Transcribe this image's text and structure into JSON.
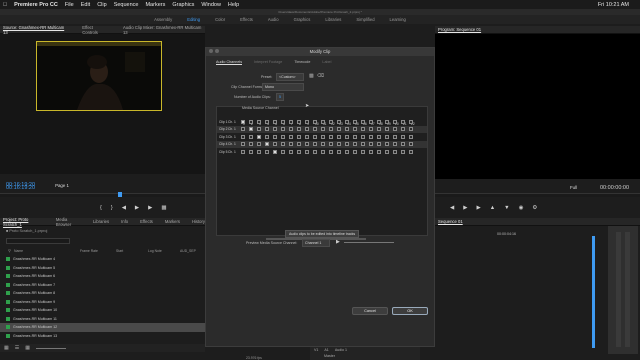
{
  "menubar": {
    "app": "Premiere Pro CC",
    "items": [
      "File",
      "Edit",
      "Clip",
      "Sequence",
      "Markers",
      "Graphics",
      "Window",
      "Help"
    ],
    "clock": "Fri 10:21 AM"
  },
  "titlebar": "/Users/dave/Documents/Adobe/Premiere Pro/Gnash_2.prproj *",
  "workspaces": {
    "items": [
      "Assembly",
      "Editing",
      "Color",
      "Effects",
      "Audio",
      "Graphics",
      "Libraries",
      "Simplified",
      "Learning"
    ]
  },
  "source_panel": {
    "tabs": [
      "Source: Gnashmex-RR Multicam 13",
      "Effect Controls",
      "Audio Clip Mixer: Gnashmex-RR Multicam 13",
      "Metadata"
    ],
    "timecode": "00:16:19:20",
    "page": "Page 1"
  },
  "program_panel": {
    "tab": "Program: Sequence 01",
    "zoom": "Full",
    "timecode": "00:00:00:00"
  },
  "project_panel": {
    "tabs": [
      "Project: Proto Scratch_1",
      "Media Browser",
      "Libraries",
      "Info",
      "Effects",
      "Markers",
      "History"
    ],
    "path": "Proto Scratch_1.prproj",
    "columns": [
      "Name",
      "Frame Rate",
      "Start",
      "Log Note",
      "AUD_SEP"
    ],
    "rows": [
      "Gnashmex-RR Multicam 4",
      "Gnashmex-RR Multicam 5",
      "Gnashmex-RR Multicam 6",
      "Gnashmex-RR Multicam 7",
      "Gnashmex-RR Multicam 8",
      "Gnashmex-RR Multicam 9",
      "Gnashmex-RR Multicam 10",
      "Gnashmex-RR Multicam 11",
      "Gnashmex-RR Multicam 12",
      "Gnashmex-RR Multicam 13"
    ],
    "fps": "23.976 fps"
  },
  "timeline": {
    "tab": "Sequence 01",
    "timecode": "00:00:04:16",
    "tracks": [
      "V1",
      "A1",
      "Master"
    ],
    "track_label": "Audio 1"
  },
  "dialog": {
    "title": "Modify Clip",
    "tabs": [
      "Audio Channels",
      "Interpret Footage",
      "Timecode",
      "Label"
    ],
    "preset_label": "Preset:",
    "preset_value": "<Custom>",
    "format_label": "Clip Channel Format:",
    "format_value": "Mono",
    "num_label": "Number of Audio Clips:",
    "num_value": "5",
    "media_source_label": "Media Source Channel",
    "channel_numbers": [
      "1",
      "2",
      "3",
      "4",
      "5",
      "6",
      "7",
      "8",
      "9",
      "10",
      "11",
      "12",
      "13",
      "14",
      "15",
      "16",
      "17",
      "18",
      "19",
      "20",
      "21",
      "22"
    ],
    "clip_rows": [
      {
        "clip": "Clip 1",
        "ch": "Ch. 1",
        "checked": 1
      },
      {
        "clip": "Clip 2",
        "ch": "Ch. 1",
        "checked": 2
      },
      {
        "clip": "Clip 3",
        "ch": "Ch. 1",
        "checked": 3
      },
      {
        "clip": "Clip 4",
        "ch": "Ch. 1",
        "checked": 4
      },
      {
        "clip": "Clip 5",
        "ch": "Ch. 1",
        "checked": 5
      }
    ],
    "tooltip": "Audio clips to be edited into timeline tracks",
    "preview_label": "Preview Media Source Channel:",
    "preview_value": "Channel 1",
    "cancel": "Cancel",
    "ok": "OK"
  }
}
